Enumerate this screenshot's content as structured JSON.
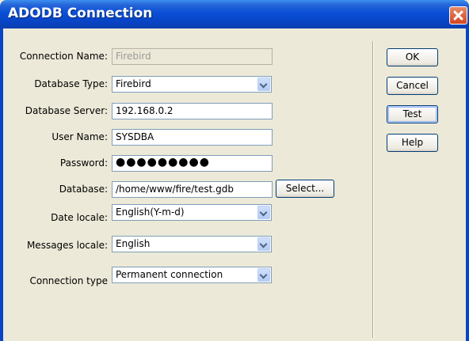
{
  "window": {
    "title": "ADODB Connection"
  },
  "form": {
    "connection_name": {
      "label": "Connection Name:",
      "value": "Firebird"
    },
    "database_type": {
      "label": "Database Type:",
      "value": "Firebird"
    },
    "database_server": {
      "label": "Database Server:",
      "value": "192.168.0.2"
    },
    "user_name": {
      "label": "User Name:",
      "value": "SYSDBA"
    },
    "password": {
      "label": "Password:",
      "value": "●●●●●●●●●"
    },
    "database": {
      "label": "Database:",
      "value": "/home/www/fire/test.gdb",
      "select_button": "Select..."
    },
    "date_locale": {
      "label": "Date locale:",
      "value": "English(Y-m-d)"
    },
    "messages_locale": {
      "label": "Messages locale:",
      "value": "English"
    },
    "connection_type": {
      "label": "Connection type",
      "value": "Permanent connection"
    }
  },
  "buttons": {
    "ok": "OK",
    "cancel": "Cancel",
    "test": "Test",
    "help": "Help"
  },
  "colors": {
    "titlebar": "#0a4fd6",
    "dialog_bg": "#ece9d8",
    "close": "#d5441f"
  }
}
